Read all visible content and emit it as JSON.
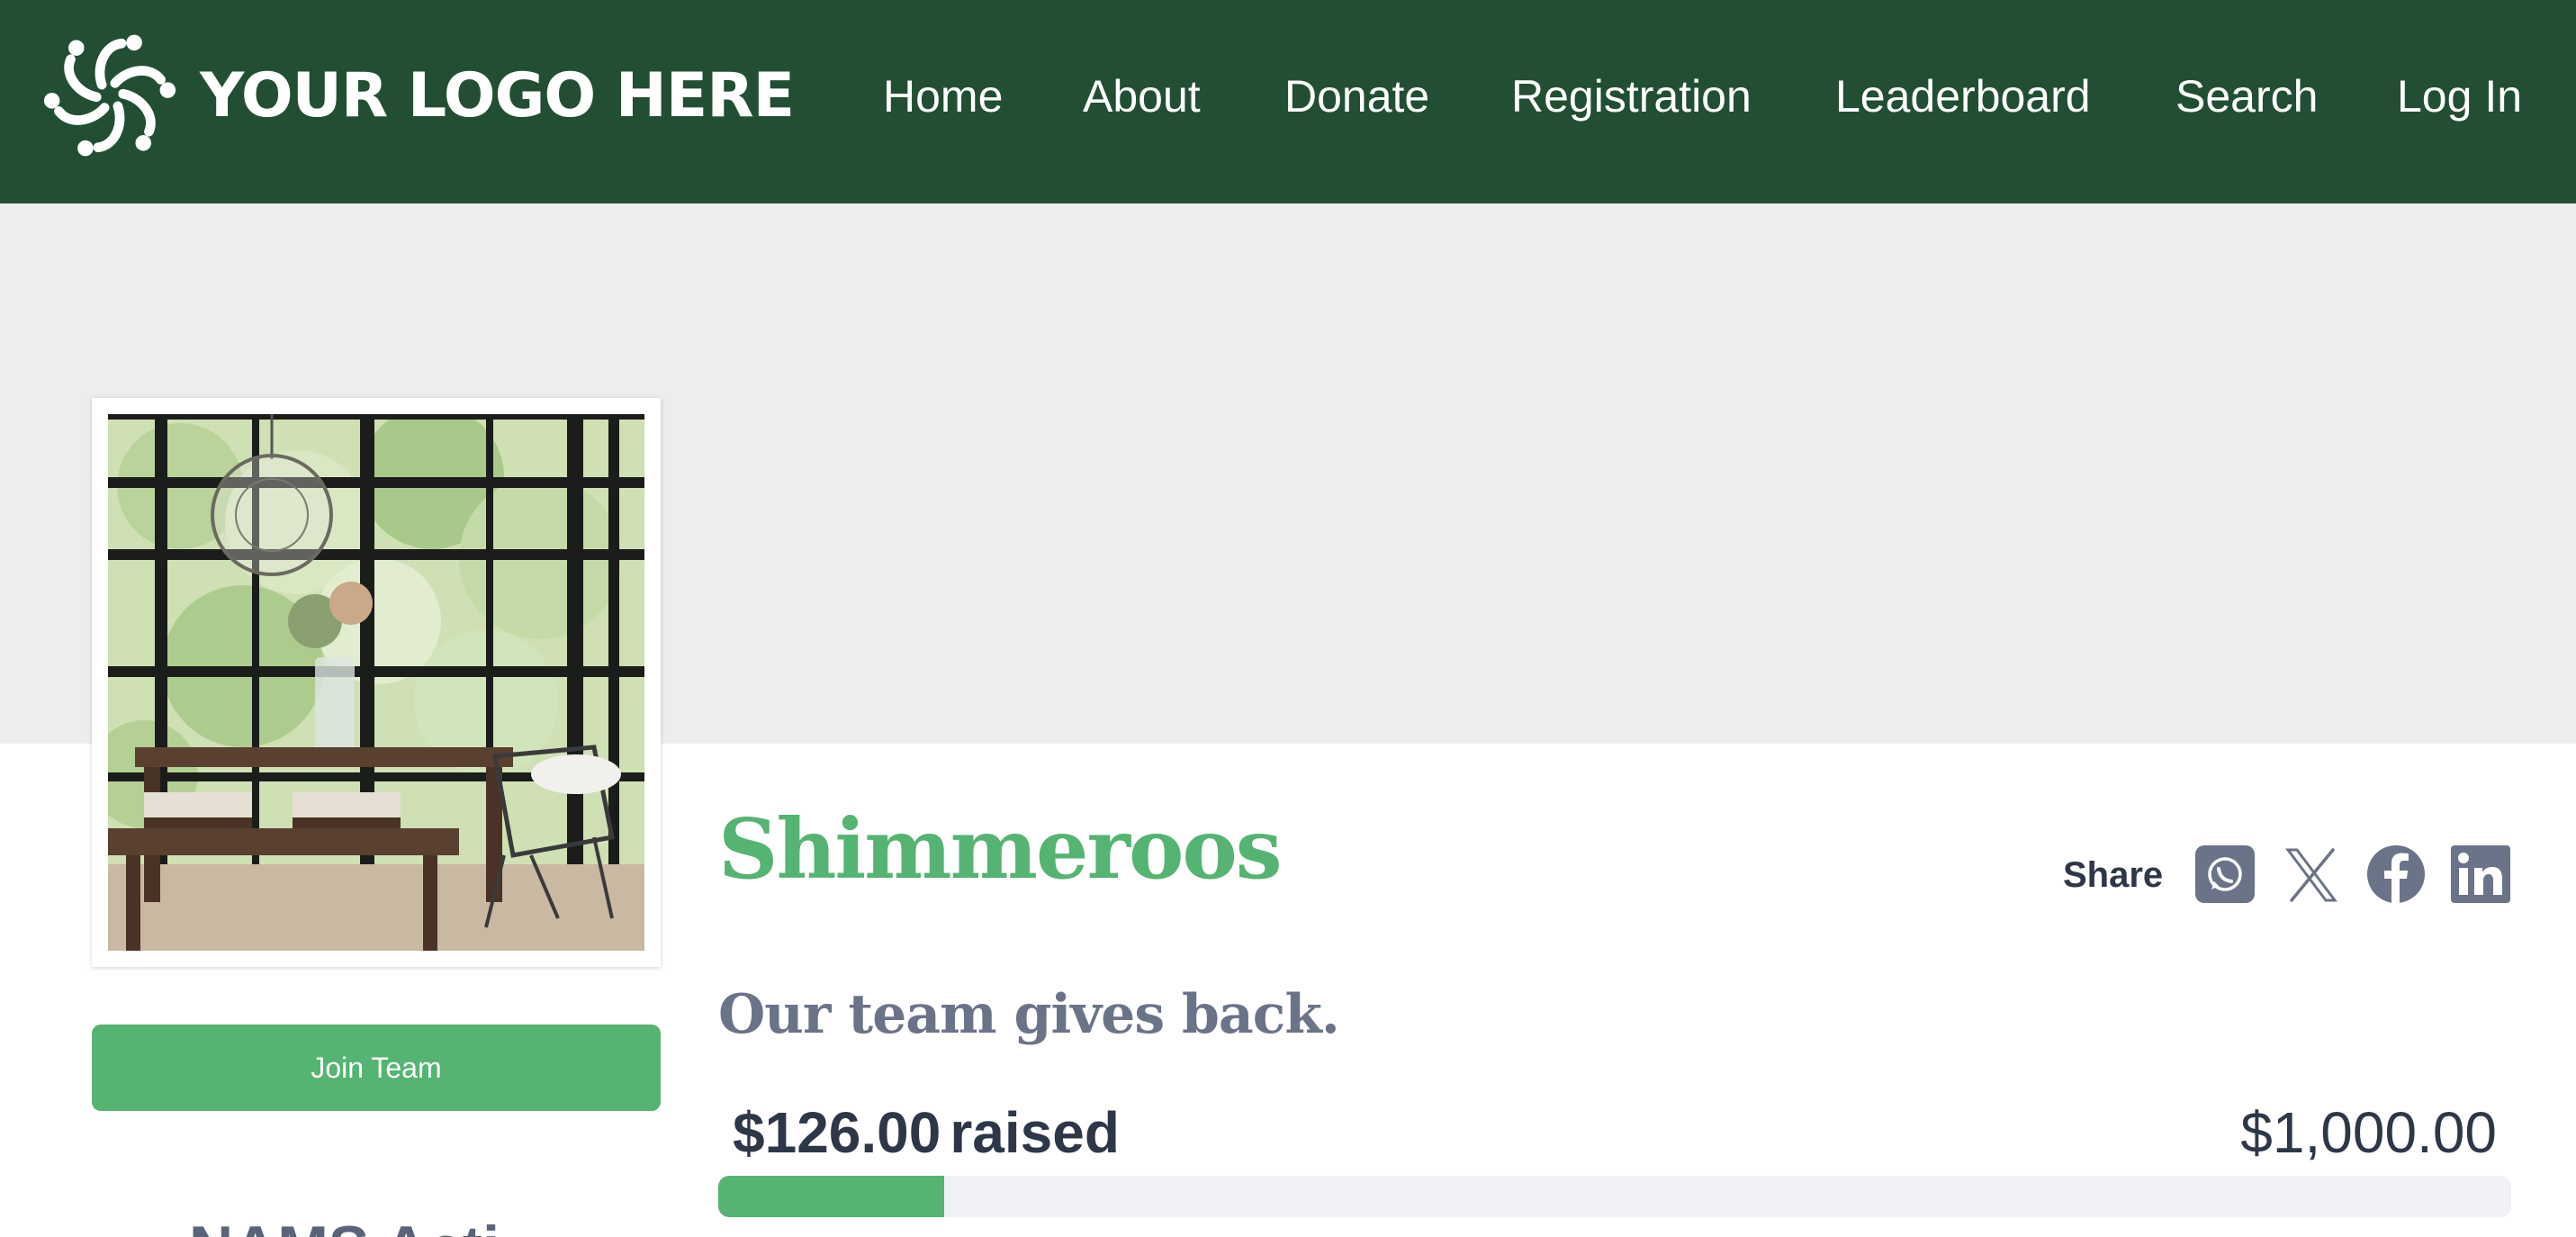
{
  "header": {
    "logo_text": "YOUR LOGO HERE",
    "nav": [
      {
        "id": "home",
        "label": "Home"
      },
      {
        "id": "about",
        "label": "About"
      },
      {
        "id": "donate",
        "label": "Donate"
      },
      {
        "id": "registration",
        "label": "Registration"
      },
      {
        "id": "leaderboard",
        "label": "Leaderboard"
      },
      {
        "id": "search",
        "label": "Search"
      },
      {
        "id": "login",
        "label": "Log In"
      }
    ]
  },
  "sidebar": {
    "join_label": "Join Team",
    "partial_heading": "NAMS Acti"
  },
  "team": {
    "name": "Shimmeroos",
    "tagline": "Our team gives back.",
    "share_label": "Share",
    "share_icons": [
      "whatsapp-icon",
      "x-icon",
      "facebook-icon",
      "linkedin-icon"
    ]
  },
  "fundraising": {
    "raised_amount": "$126.00",
    "raised_label": "raised",
    "goal_amount": "$1,000.00",
    "progress_fraction": 0.126
  },
  "colors": {
    "header_bg": "#224f33",
    "accent_green": "#55b472",
    "banner_bg": "#ededed",
    "text_dark": "#2e3748",
    "text_muted": "#6b7388",
    "icon_slate": "#6b7388"
  }
}
